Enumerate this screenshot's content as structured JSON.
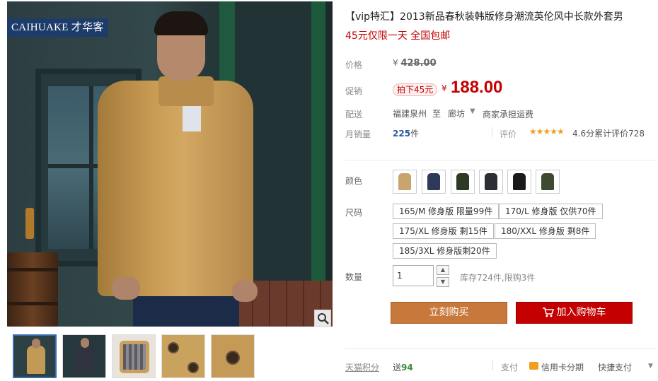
{
  "brand": {
    "logo_text": "CAIHUAKE 才华客"
  },
  "product": {
    "title": "【vip特汇】2013新品春秋装韩版修身潮流英伦风中长款外套男",
    "subtitle": "45元仅限一天 全国包邮"
  },
  "price": {
    "label": "价格",
    "currency": "¥",
    "original": "428.00"
  },
  "promo": {
    "label": "促销",
    "badge": "拍下45元",
    "currency": "¥",
    "price": "188.00"
  },
  "shipping": {
    "label": "配送",
    "from": "福建泉州",
    "sep": "至",
    "to": "廊坊",
    "fee": "商家承担运费"
  },
  "sales": {
    "label": "月销量",
    "count": "225",
    "unit": "件"
  },
  "rating": {
    "label": "评价",
    "stars": "★★★★★",
    "text": "4.6分累计评价728"
  },
  "colors": {
    "label": "颜色",
    "swatches": [
      {
        "name": "khaki-coat",
        "color": "#c9a56e"
      },
      {
        "name": "navy-coat",
        "color": "#2e3a5a"
      },
      {
        "name": "olive-coat",
        "color": "#2f3a24"
      },
      {
        "name": "dark-grey-coat",
        "color": "#2b2f33"
      },
      {
        "name": "black-coat",
        "color": "#1a1a1a"
      },
      {
        "name": "army-green-coat",
        "color": "#3d4a30"
      }
    ]
  },
  "sizes": {
    "label": "尺码",
    "options": [
      "165/M 修身版 限量99件",
      "170/L 修身版 仅供70件",
      "175/XL 修身版 剩15件",
      "180/XXL 修身版 剩8件",
      "185/3XL 修身版剩20件"
    ]
  },
  "quantity": {
    "label": "数量",
    "value": "1",
    "stock": "库存724件,限购3件"
  },
  "actions": {
    "buy_now": "立刻购买",
    "add_to_cart": "加入购物车"
  },
  "footer": {
    "points_label": "天猫积分",
    "points_prefix": "送",
    "points_value": "94",
    "pay_label": "支付",
    "credit_text": "信用卡分期",
    "quick_pay": "快捷支付"
  },
  "icons": {
    "zoom": "magnifier-icon",
    "cart": "cart-icon",
    "credit": "credit-card-icon"
  },
  "theme": {
    "accent_red": "#c40000",
    "buy_orange": "#c8783a",
    "link_blue": "#2c5a9b",
    "star_orange": "#f0a020"
  }
}
